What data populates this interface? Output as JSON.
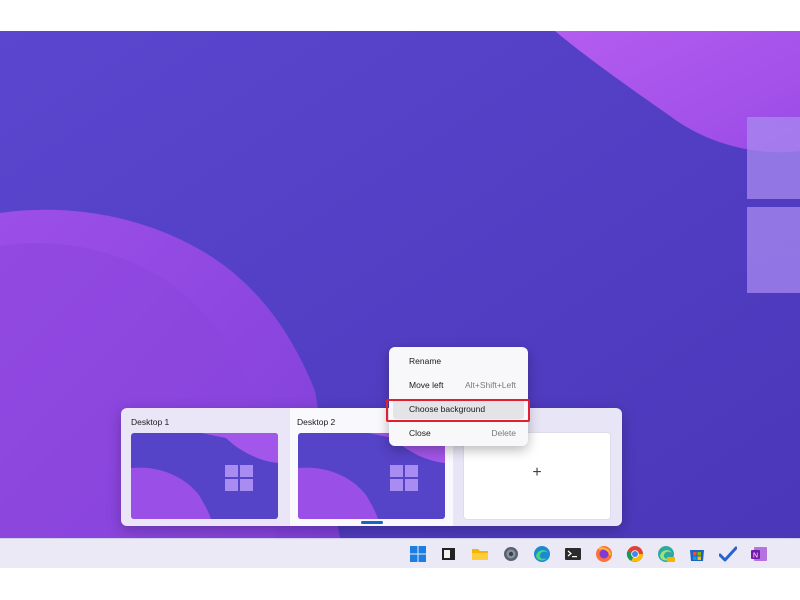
{
  "desktop_switcher": {
    "desktops": [
      {
        "label": "Desktop 1"
      },
      {
        "label": "Desktop 2"
      }
    ],
    "new_desktop_symbol": "+"
  },
  "context_menu": {
    "items": [
      {
        "label": "Rename",
        "shortcut": ""
      },
      {
        "label": "Move left",
        "shortcut": "Alt+Shift+Left"
      },
      {
        "label": "Choose background",
        "shortcut": ""
      },
      {
        "label": "Close",
        "shortcut": "Delete"
      }
    ],
    "highlighted_item": "Choose background",
    "highlight_color": "#e02030"
  },
  "taskbar": {
    "icons": [
      "windows-start-icon",
      "task-view-icon",
      "file-explorer-icon",
      "settings-icon",
      "edge-icon",
      "terminal-icon",
      "firefox-icon",
      "chrome-icon",
      "edge-canary-icon",
      "microsoft-store-icon",
      "todo-icon",
      "onenote-icon"
    ]
  },
  "colors": {
    "wallpaper_base": "#5a3ec6",
    "wallpaper_accent": "#a855e8",
    "accent": "#1a63c7"
  }
}
